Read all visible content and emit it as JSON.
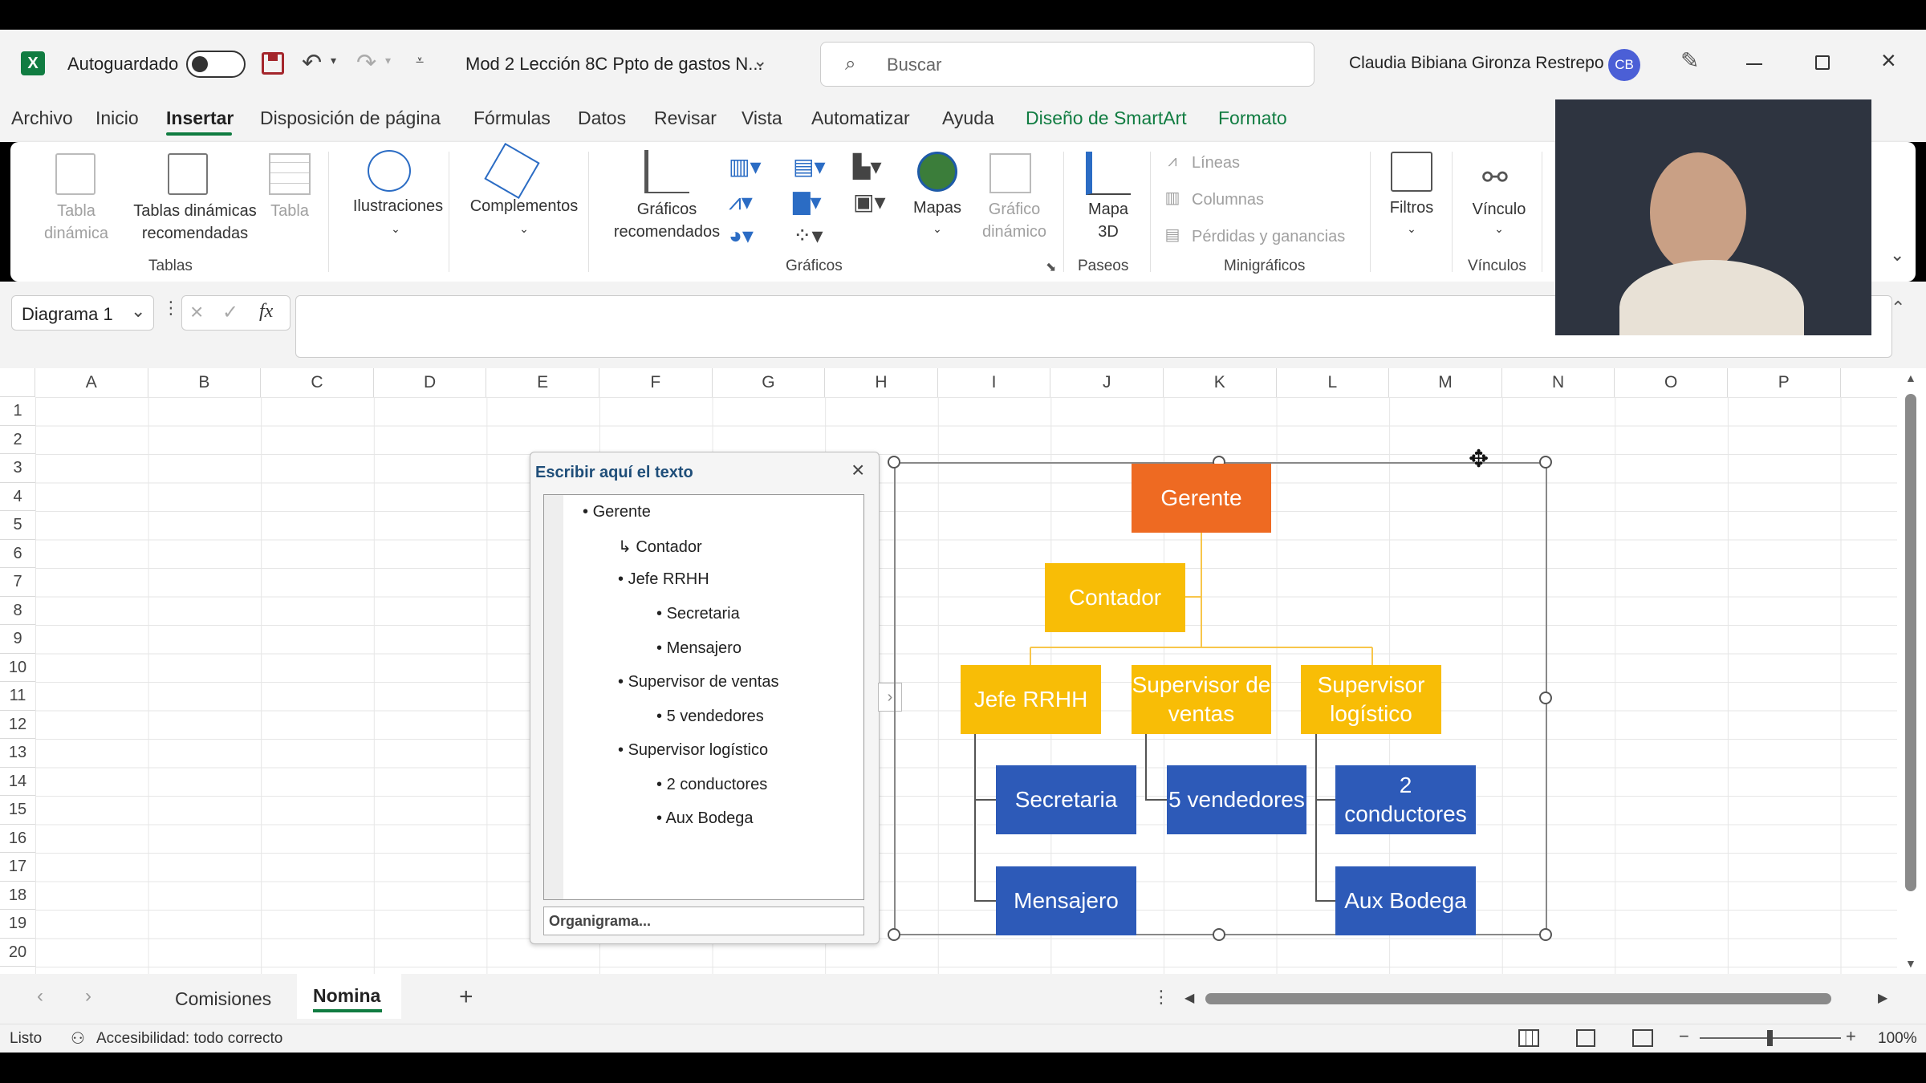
{
  "titlebar": {
    "autosave_label": "Autoguardado",
    "doc_title": "Mod 2 Lección 8C Ppto de gastos N...",
    "search_placeholder": "Buscar",
    "user_name": "Claudia Bibiana Gironza Restrepo",
    "user_initials": "CB"
  },
  "menu": [
    "Archivo",
    "Inicio",
    "Insertar",
    "Disposición de página",
    "Fórmulas",
    "Datos",
    "Revisar",
    "Vista",
    "Automatizar",
    "Ayuda",
    "Diseño de SmartArt",
    "Formato"
  ],
  "ribbon": {
    "tabla_dinamica": "Tabla dinámica",
    "tablas_dinamicas_rec": "Tablas dinámicas recomendadas",
    "tabla": "Tabla",
    "group_tablas": "Tablas",
    "ilustraciones": "Ilustraciones",
    "complementos": "Complementos",
    "graficos_rec": "Gráficos recomendados",
    "mapas": "Mapas",
    "grafico_dinamico": "Gráfico dinámico",
    "group_graficos": "Gráficos",
    "mapa3d": "Mapa 3D",
    "group_paseos": "Paseos",
    "lineas": "Líneas",
    "columnas": "Columnas",
    "perdidas": "Pérdidas y ganancias",
    "group_minigraficos": "Minigráficos",
    "filtros": "Filtros",
    "vinculo": "Vínculo",
    "group_vinculos": "Vínculos"
  },
  "formula": {
    "name_box": "Diagrama 1",
    "fx": "fx"
  },
  "columns": [
    "A",
    "B",
    "C",
    "D",
    "E",
    "F",
    "G",
    "H",
    "I",
    "J",
    "K",
    "L",
    "M",
    "N",
    "O",
    "P"
  ],
  "rows": [
    "1",
    "2",
    "3",
    "4",
    "5",
    "6",
    "7",
    "8",
    "9",
    "10",
    "11",
    "12",
    "13",
    "14",
    "15",
    "16",
    "17",
    "18",
    "19",
    "20"
  ],
  "text_pane": {
    "title": "Escribir aquí el texto",
    "items": [
      "Gerente",
      "Contador",
      "Jefe RRHH",
      "Secretaria",
      "Mensajero",
      "Supervisor de ventas",
      "5 vendedores",
      "Supervisor logístico",
      "2 conductores",
      "Aux Bodega"
    ],
    "footer": "Organigrama..."
  },
  "org": {
    "gerente": "Gerente",
    "contador": "Contador",
    "jefe": "Jefe RRHH",
    "sup_ventas": "Supervisor de ventas",
    "sup_log": "Supervisor logístico",
    "secretaria": "Secretaria",
    "vendedores": "5 vendedores",
    "conductores": "2 conductores",
    "mensajero": "Mensajero",
    "aux": "Aux Bodega"
  },
  "tabs": {
    "t1": "Comisiones",
    "t2": "Nomina",
    "add": "+"
  },
  "status": {
    "ready": "Listo",
    "accessibility": "Accesibilidad: todo correcto",
    "zoom": "100%"
  },
  "colors": {
    "orange": "#ee6a22",
    "yellow": "#f8bd06",
    "blue": "#2d5ab8",
    "excel_green": "#107c41",
    "smartart_green": "#107c41"
  }
}
